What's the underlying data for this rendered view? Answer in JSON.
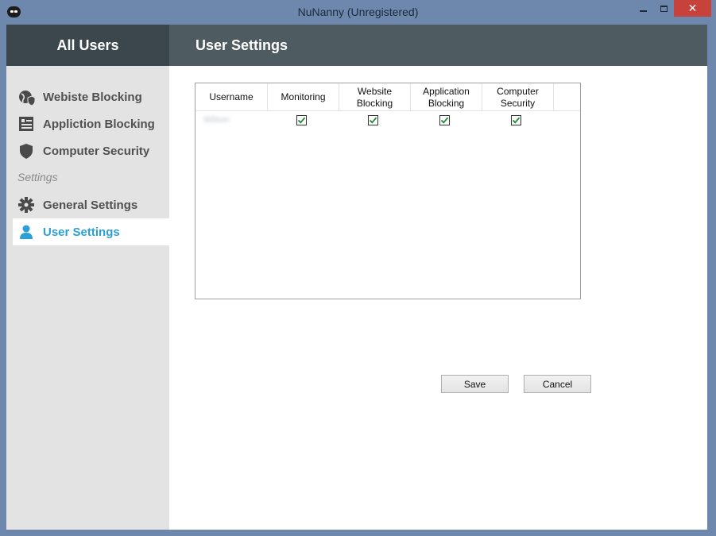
{
  "window": {
    "title": "NuNanny  (Unregistered)",
    "close_glyph": "✕"
  },
  "header": {
    "left_label": "All Users",
    "title": "User Settings"
  },
  "sidebar": {
    "items": [
      {
        "label": "Webiste Blocking",
        "icon": "globe-shield-icon"
      },
      {
        "label": "Appliction Blocking",
        "icon": "app-list-icon"
      },
      {
        "label": "Computer Security",
        "icon": "shield-icon"
      }
    ],
    "section_label": "Settings",
    "settings_items": [
      {
        "label": "General Settings",
        "icon": "gear-icon"
      },
      {
        "label": "User Settings",
        "icon": "user-icon",
        "active": true
      }
    ]
  },
  "table": {
    "columns": [
      "Username",
      "Monitoring",
      "Website\nBlocking",
      "Application\nBlocking",
      "Computer\nSecurity"
    ],
    "rows": [
      {
        "username": "Wilson",
        "monitoring": true,
        "website_blocking": true,
        "application_blocking": true,
        "computer_security": true
      }
    ]
  },
  "buttons": {
    "save": "Save",
    "cancel": "Cancel"
  },
  "colors": {
    "accent": "#2a9fd8",
    "header_bg": "#4e5b61",
    "sidebar_bg": "#e3e3e3",
    "check_green": "#1e8a2e"
  }
}
